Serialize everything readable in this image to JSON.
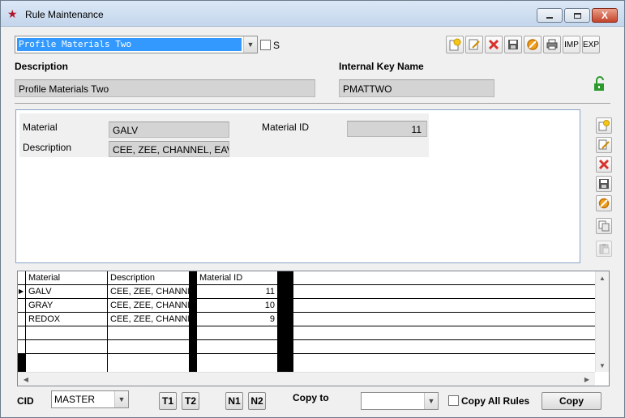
{
  "window": {
    "title": "Rule Maintenance",
    "close_glyph": "X"
  },
  "top": {
    "rule_select": {
      "value": "Profile Materials Two"
    },
    "s_checkbox_label": "S",
    "description_label": "Description",
    "description_value": "Profile Materials Two",
    "key_label": "Internal Key Name",
    "key_value": "PMATTWO",
    "toolbar": {
      "imp": "IMP",
      "exp": "EXP"
    }
  },
  "detail": {
    "material_label": "Material",
    "material_value": "GALV",
    "description_label": "Description",
    "description_value": "CEE, ZEE, CHANNEL, EAV",
    "material_id_label": "Material ID",
    "material_id_value": "11"
  },
  "grid": {
    "columns": [
      "Material",
      "Description",
      "Material ID"
    ],
    "rows": [
      {
        "material": "GALV",
        "description": "CEE, ZEE, CHANNEL",
        "material_id": "11"
      },
      {
        "material": "GRAY",
        "description": "CEE, ZEE, CHANNEL",
        "material_id": "10"
      },
      {
        "material": "REDOX",
        "description": "CEE, ZEE, CHANNEL",
        "material_id": "9"
      }
    ]
  },
  "bottom": {
    "cid_label": "CID",
    "cid_value": "MASTER",
    "t1": "T1",
    "t2": "T2",
    "n1": "N1",
    "n2": "N2",
    "copy_to_label": "Copy to",
    "copy_to_value": "",
    "copy_all_label": "Copy All Rules",
    "copy_button": "Copy"
  },
  "icons": {
    "app": "star-icon",
    "new": "new-record-icon",
    "edit": "edit-record-icon",
    "delete": "delete-record-icon",
    "save": "save-icon",
    "cancel": "cancel-icon",
    "print": "print-icon",
    "unlock": "unlock-icon"
  },
  "colors": {
    "selection": "#3399ff",
    "panel_border": "#8aa4c8",
    "delete": "#d8322d",
    "cancel": "#f0a020",
    "unlock": "#2e9a2e"
  }
}
